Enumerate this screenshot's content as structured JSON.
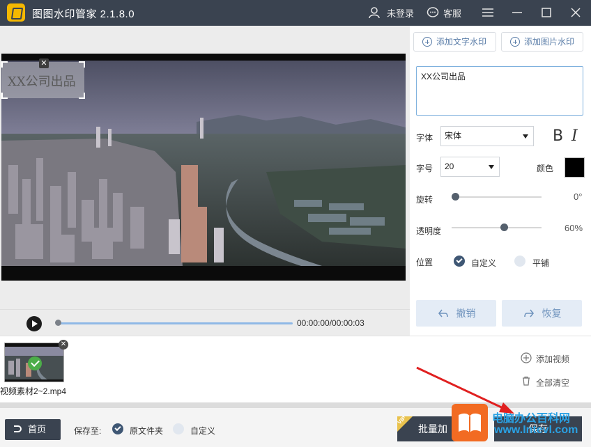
{
  "app": {
    "title": "图图水印管家 2.1.8.0"
  },
  "titlebar": {
    "login": "未登录",
    "service": "客服"
  },
  "video": {
    "watermark_text": "XX公司出品",
    "time": "00:00:00/00:00:03",
    "progress": 0
  },
  "panel": {
    "add_text_watermark": "添加文字水印",
    "add_image_watermark": "添加图片水印",
    "text_value": "XX公司出品",
    "font_label": "字体",
    "font_value": "宋体",
    "bold": "B",
    "italic": "I",
    "size_label": "字号",
    "size_value": "20",
    "color_label": "颜色",
    "color_value": "#000000",
    "rotate_label": "旋转",
    "rotate_value": "0°",
    "opacity_label": "透明度",
    "opacity_value": "60%",
    "position_label": "位置",
    "position_custom": "自定义",
    "position_tile": "平铺",
    "undo": "撤销",
    "redo": "恢复"
  },
  "files": {
    "name": "视频素材2~2.mp4",
    "add_video": "添加视频",
    "clear_all": "全部清空"
  },
  "bottom": {
    "home": "首页",
    "save_to": "保存至:",
    "original_folder": "原文件夹",
    "custom": "自定义",
    "batch_add": "批量加",
    "vip": "VIP",
    "save": "保存",
    "brand_text": "电脑办公百科网",
    "brand_url": "www.Intevl.com"
  },
  "colors": {
    "titlebar": "#3a4350",
    "accent": "#5a7da8"
  }
}
